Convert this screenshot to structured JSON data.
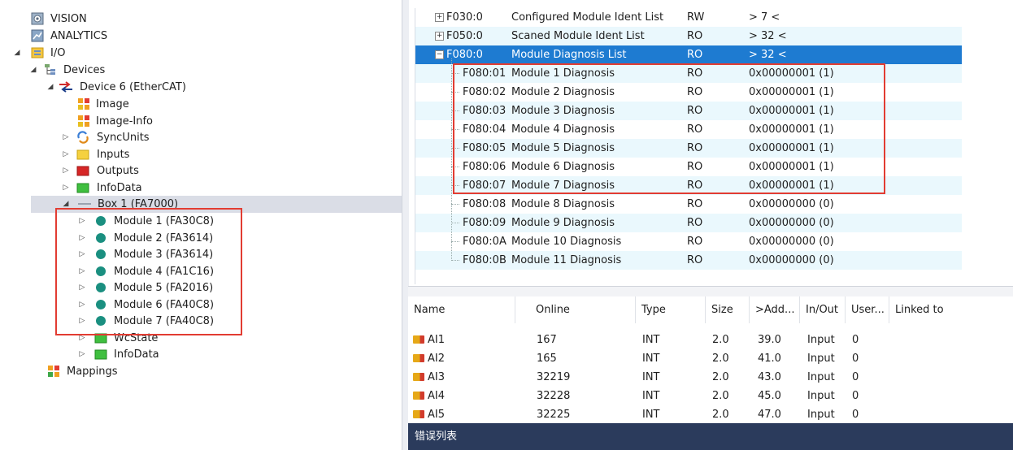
{
  "tree": {
    "items": [
      {
        "label": "VISION",
        "icon": "vision-icon",
        "expander": ""
      },
      {
        "label": "ANALYTICS",
        "icon": "analytics-icon",
        "expander": ""
      },
      {
        "label": "I/O",
        "icon": "io-folder-icon",
        "expander": "◢"
      },
      {
        "label": "Devices",
        "icon": "devices-icon",
        "expander": "◢"
      },
      {
        "label": "Device 6 (EtherCAT)",
        "icon": "ethercat-icon",
        "expander": "◢"
      },
      {
        "label": "Image",
        "icon": "image-icon",
        "expander": ""
      },
      {
        "label": "Image-Info",
        "icon": "image-info-icon",
        "expander": ""
      },
      {
        "label": "SyncUnits",
        "icon": "syncunits-icon",
        "expander": "▷"
      },
      {
        "label": "Inputs",
        "icon": "inputs-folder-icon",
        "expander": "▷"
      },
      {
        "label": "Outputs",
        "icon": "outputs-folder-icon",
        "expander": "▷"
      },
      {
        "label": "InfoData",
        "icon": "infodata-folder-icon",
        "expander": "▷"
      },
      {
        "label": "Box 1 (FA7000)",
        "icon": "box-icon",
        "expander": "◢"
      },
      {
        "label": "Module 1 (FA30C8)",
        "icon": "module-icon",
        "expander": "▷"
      },
      {
        "label": "Module 2 (FA3614)",
        "icon": "module-icon",
        "expander": "▷"
      },
      {
        "label": "Module 3 (FA3614)",
        "icon": "module-icon",
        "expander": "▷"
      },
      {
        "label": "Module 4 (FA1C16)",
        "icon": "module-icon",
        "expander": "▷"
      },
      {
        "label": "Module 5 (FA2016)",
        "icon": "module-icon",
        "expander": "▷"
      },
      {
        "label": "Module 6 (FA40C8)",
        "icon": "module-icon",
        "expander": "▷"
      },
      {
        "label": "Module 7 (FA40C8)",
        "icon": "module-icon",
        "expander": "▷"
      },
      {
        "label": "WcState",
        "icon": "wcstate-icon",
        "expander": "▷"
      },
      {
        "label": "InfoData",
        "icon": "infodata-folder-icon",
        "expander": "▷"
      },
      {
        "label": "Mappings",
        "icon": "mappings-icon",
        "expander": ""
      }
    ]
  },
  "coe": {
    "rows": [
      {
        "index": "F030:0",
        "name": "Configured Module Ident List",
        "flags": "RW",
        "value": "> 7 <",
        "expander": "+"
      },
      {
        "index": "F050:0",
        "name": "Scaned Module Ident List",
        "flags": "RO",
        "value": "> 32 <",
        "expander": "+"
      },
      {
        "index": "F080:0",
        "name": "Module Diagnosis List",
        "flags": "RO",
        "value": "> 32 <",
        "expander": "−"
      },
      {
        "index": "F080:01",
        "name": "Module 1 Diagnosis",
        "flags": "RO",
        "value": "0x00000001 (1)",
        "expander": ""
      },
      {
        "index": "F080:02",
        "name": "Module 2 Diagnosis",
        "flags": "RO",
        "value": "0x00000001 (1)",
        "expander": ""
      },
      {
        "index": "F080:03",
        "name": "Module 3 Diagnosis",
        "flags": "RO",
        "value": "0x00000001 (1)",
        "expander": ""
      },
      {
        "index": "F080:04",
        "name": "Module 4 Diagnosis",
        "flags": "RO",
        "value": "0x00000001 (1)",
        "expander": ""
      },
      {
        "index": "F080:05",
        "name": "Module 5 Diagnosis",
        "flags": "RO",
        "value": "0x00000001 (1)",
        "expander": ""
      },
      {
        "index": "F080:06",
        "name": "Module 6 Diagnosis",
        "flags": "RO",
        "value": "0x00000001 (1)",
        "expander": ""
      },
      {
        "index": "F080:07",
        "name": "Module 7 Diagnosis",
        "flags": "RO",
        "value": "0x00000001 (1)",
        "expander": ""
      },
      {
        "index": "F080:08",
        "name": "Module 8 Diagnosis",
        "flags": "RO",
        "value": "0x00000000 (0)",
        "expander": ""
      },
      {
        "index": "F080:09",
        "name": "Module 9 Diagnosis",
        "flags": "RO",
        "value": "0x00000000 (0)",
        "expander": ""
      },
      {
        "index": "F080:0A",
        "name": "Module 10 Diagnosis",
        "flags": "RO",
        "value": "0x00000000 (0)",
        "expander": ""
      },
      {
        "index": "F080:0B",
        "name": "Module 11 Diagnosis",
        "flags": "RO",
        "value": "0x00000000 (0)",
        "expander": ""
      }
    ]
  },
  "grid": {
    "headers": [
      "Name",
      "Online",
      "Type",
      "Size",
      ">Add...",
      "In/Out",
      "User...",
      "Linked to"
    ],
    "rows": [
      {
        "name": "AI1",
        "online": "167",
        "type": "INT",
        "size": "2.0",
        "addr": "39.0",
        "inout": "Input",
        "user": "0"
      },
      {
        "name": "AI2",
        "online": "165",
        "type": "INT",
        "size": "2.0",
        "addr": "41.0",
        "inout": "Input",
        "user": "0"
      },
      {
        "name": "AI3",
        "online": "32219",
        "type": "INT",
        "size": "2.0",
        "addr": "43.0",
        "inout": "Input",
        "user": "0"
      },
      {
        "name": "AI4",
        "online": "32228",
        "type": "INT",
        "size": "2.0",
        "addr": "45.0",
        "inout": "Input",
        "user": "0"
      },
      {
        "name": "AI5",
        "online": "32225",
        "type": "INT",
        "size": "2.0",
        "addr": "47.0",
        "inout": "Input",
        "user": "0"
      }
    ]
  },
  "error_list": {
    "label": "错误列表"
  },
  "colors": {
    "highlight": "#1e7bd1",
    "annotation": "#e23c32",
    "alt_row": "#eaf8fd",
    "error_bar": "#2b3b5c"
  }
}
